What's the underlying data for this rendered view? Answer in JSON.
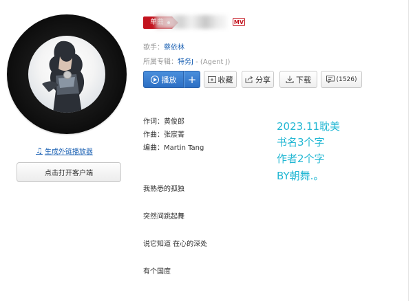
{
  "client": {
    "generate_link": "生成外链播放器",
    "open_client": "点击打开客户端"
  },
  "song": {
    "badge": "单曲",
    "mv_label": "MV",
    "singer_label": "歌手：",
    "singer": "蔡依林",
    "album_label": "所属专辑：",
    "album": "特务J",
    "album_sub": " - (Agent J)"
  },
  "actions": {
    "play": "播放",
    "add": "+",
    "collect": "收藏",
    "share": "分享",
    "download": "下载",
    "comments": "(1526)"
  },
  "credits": {
    "lyricist": "作词：黄俊郎",
    "composer": "作曲：张宸菁",
    "arranger": "编曲：Martin Tang"
  },
  "overlay_text": {
    "line1": "2023.11耽美",
    "line2": "书名3个字",
    "line3": "作者2个字",
    "line4": "BY朝舞.。"
  },
  "lyrics": {
    "line1": "我熟悉的孤独",
    "line2": "突然间跳起舞",
    "line3": "说它知道 在心的深处",
    "line4": "有个国度"
  }
}
